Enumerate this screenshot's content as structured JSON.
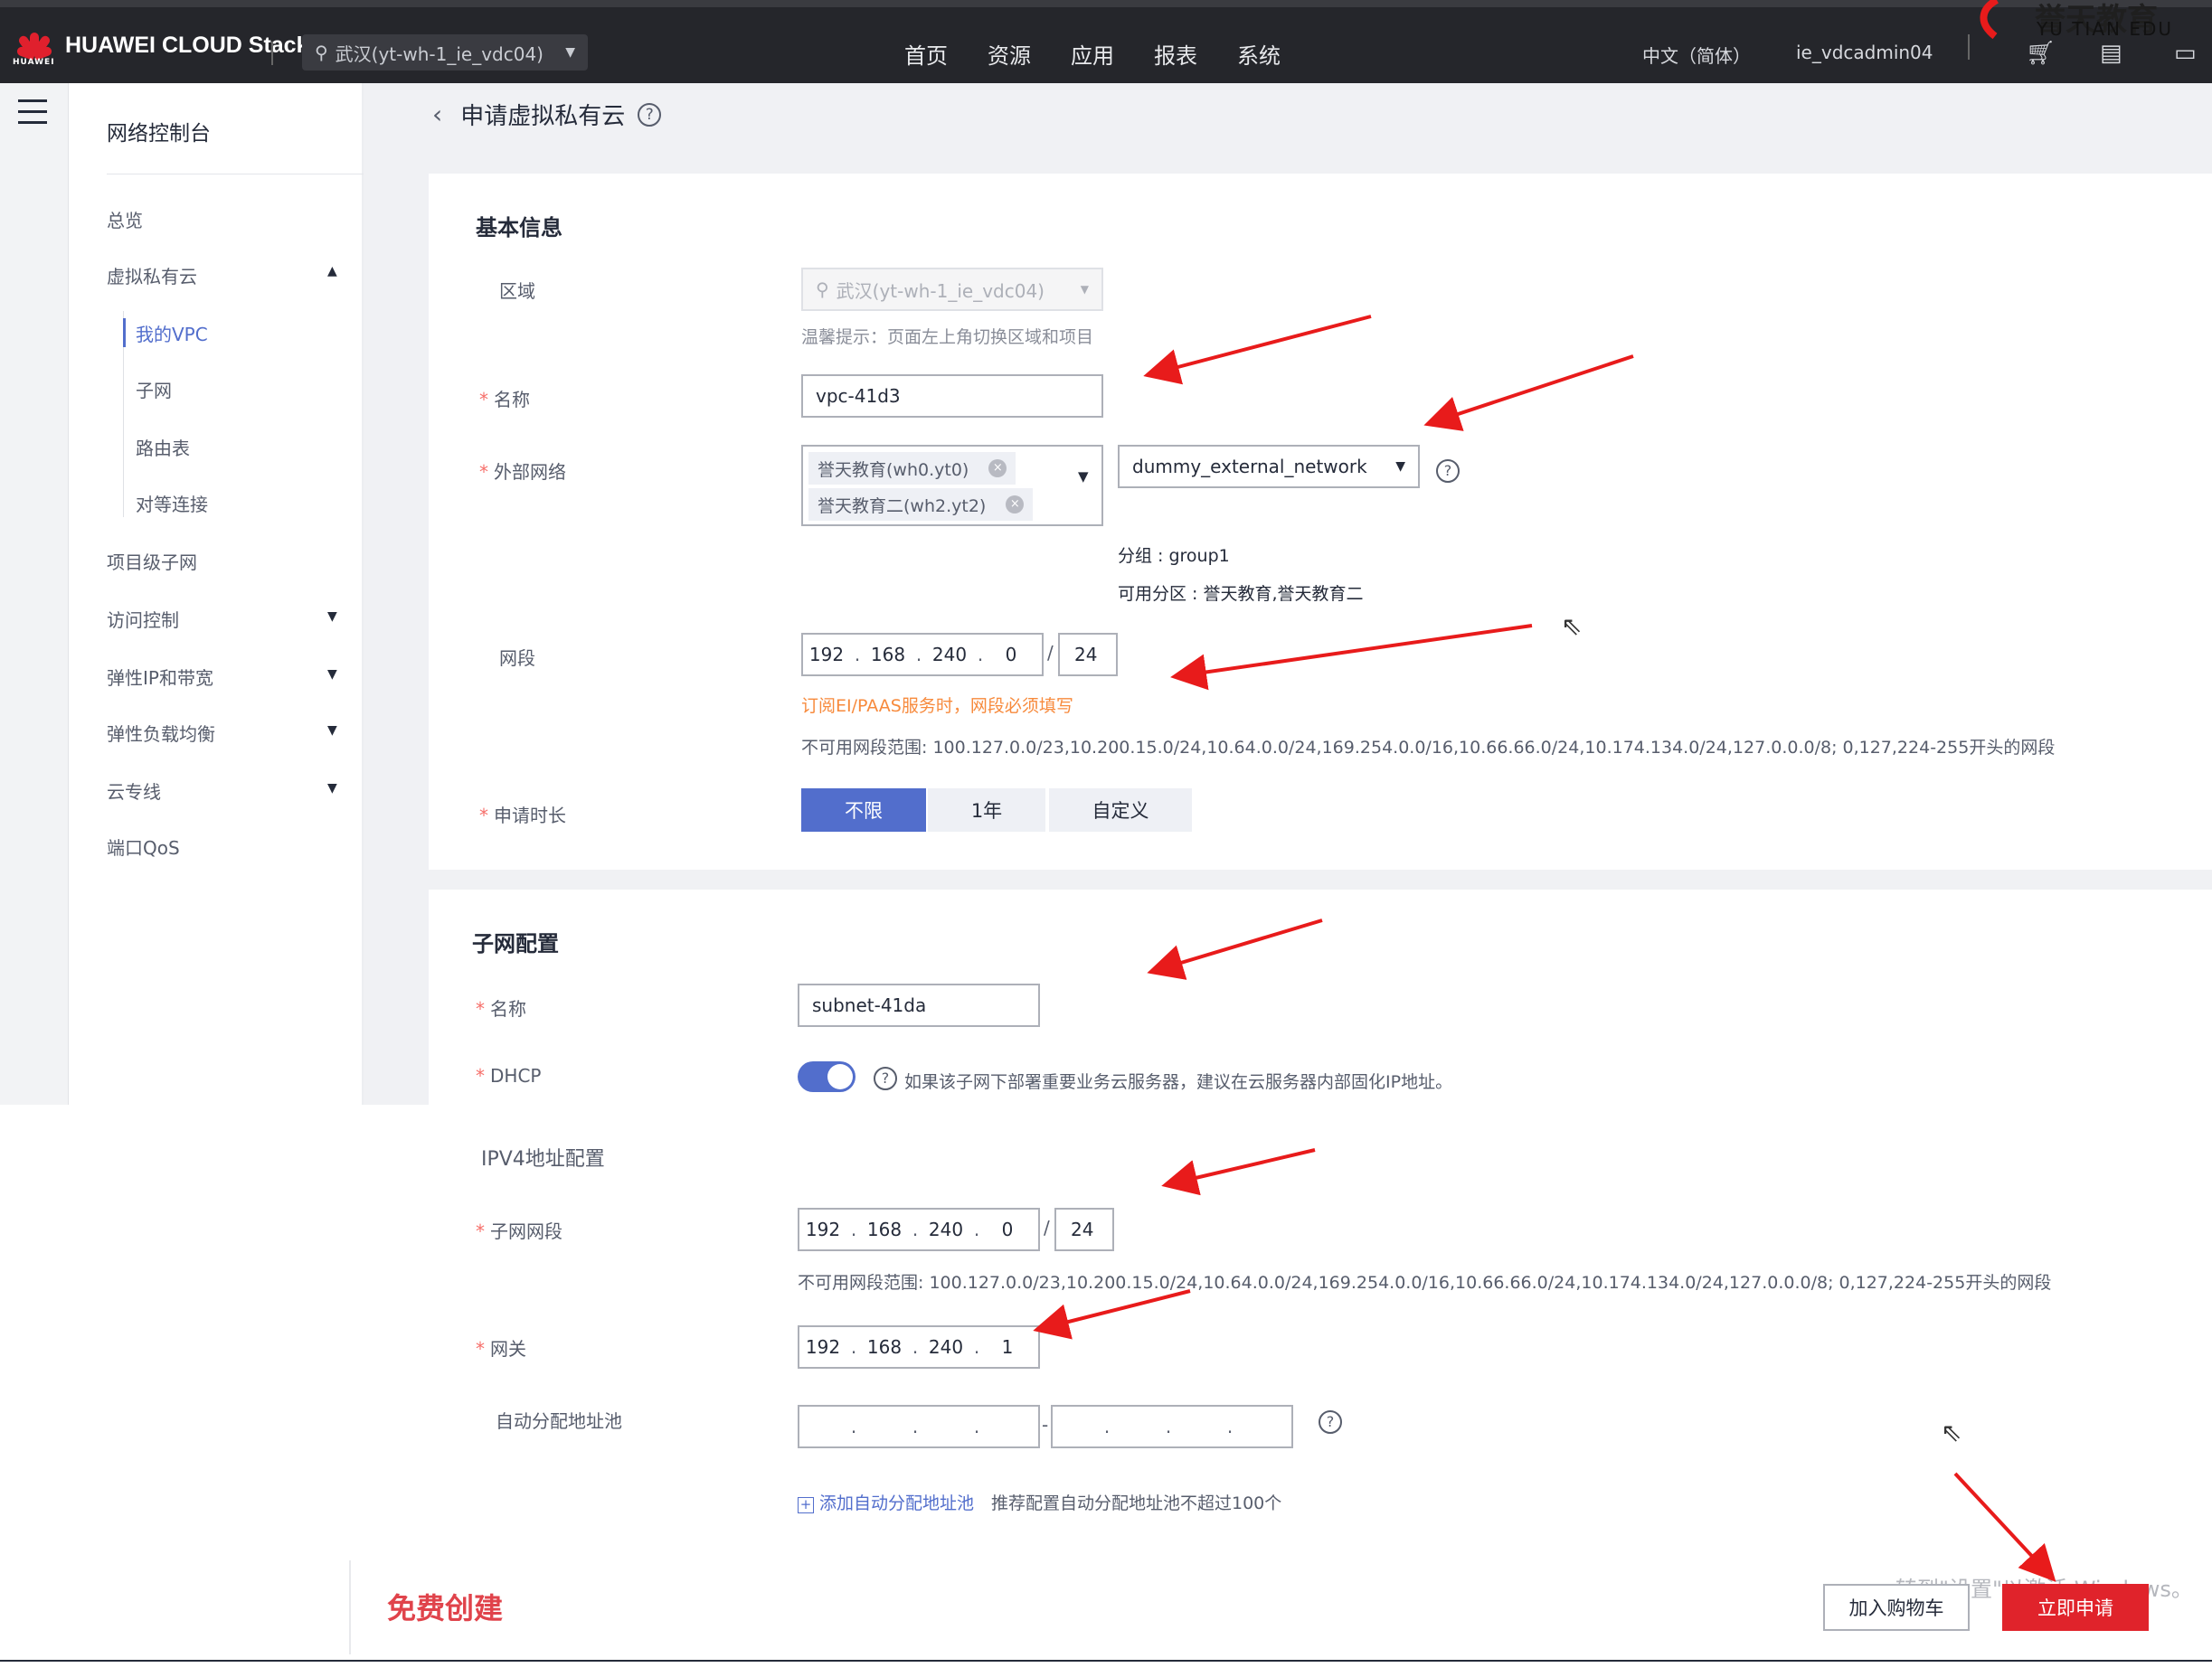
{
  "topbar": {
    "brand": "HUAWEI CLOUD Stack",
    "brand_sub": "HUAWEI",
    "region": "武汉(yt-wh-1_ie_vdc04)",
    "nav": [
      "首页",
      "资源",
      "应用",
      "报表",
      "系统"
    ],
    "language": "中文（简体）",
    "username": "ie_vdcadmin04",
    "watermark_cn": "誉天教育",
    "watermark_en": "YU TIAN EDU"
  },
  "sidebar": {
    "title": "网络控制台",
    "items": [
      "总览",
      "虚拟私有云",
      "我的VPC",
      "子网",
      "路由表",
      "对等连接",
      "项目级子网",
      "访问控制",
      "弹性IP和带宽",
      "弹性负载均衡",
      "云专线",
      "端口QoS"
    ]
  },
  "page": {
    "title": "申请虚拟私有云"
  },
  "basic": {
    "section_title": "基本信息",
    "region_label": "区域",
    "region_value": "武汉(yt-wh-1_ie_vdc04)",
    "region_tip": "温馨提示：页面左上角切换区域和项目",
    "name_label": "名称",
    "name_value": "vpc-41d3",
    "ext_network_label": "外部网络",
    "ext_network_tags": [
      "誉天教育(wh0.yt0)",
      "誉天教育二(wh2.yt2)"
    ],
    "ext_network_select": "dummy_external_network",
    "group_text": "分组 : group1",
    "az_text": "可用分区 : 誉天教育,誉天教育二",
    "segment_label": "网段",
    "segment_octets": [
      "192",
      "168",
      "240",
      "0"
    ],
    "segment_mask": "24",
    "segment_warn": "订阅EI/PAAS服务时，网段必须填写",
    "unavailable_ranges": "不可用网段范围: 100.127.0.0/23,10.200.15.0/24,10.64.0.0/24,169.254.0.0/16,10.66.66.0/24,10.174.134.0/24,127.0.0.0/8; 0,127,224-255开头的网段",
    "duration_label": "申请时长",
    "duration_options": [
      "不限",
      "1年",
      "自定义"
    ],
    "duration_selected": "不限"
  },
  "subnet": {
    "section_title": "子网配置",
    "name_label": "名称",
    "name_value": "subnet-41da",
    "dhcp_label": "DHCP",
    "dhcp_enabled": true,
    "dhcp_tip": "如果该子网下部署重要业务云服务器，建议在云服务器内部固化IP地址。",
    "ipv4_title": "IPV4地址配置",
    "segment_label": "子网网段",
    "segment_octets": [
      "192",
      "168",
      "240",
      "0"
    ],
    "segment_mask": "24",
    "unavailable_ranges": "不可用网段范围: 100.127.0.0/23,10.200.15.0/24,10.64.0.0/24,169.254.0.0/16,10.66.66.0/24,10.174.134.0/24,127.0.0.0/8; 0,127,224-255开头的网段",
    "gateway_label": "网关",
    "gateway_octets": [
      "192",
      "168",
      "240",
      "1"
    ],
    "pool_label": "自动分配地址池",
    "pool_dash": "-",
    "add_pool_link": "添加自动分配地址池",
    "add_pool_tip": "推荐配置自动分配地址池不超过100个"
  },
  "footer": {
    "free_text": "免费创建",
    "cart_button": "加入购物车",
    "apply_button": "立即申请",
    "windows_watermark": "转到\"设置\"以激活 Windows。"
  },
  "colors": {
    "accent": "#526ecc",
    "annotation_arrow": "#e81b1b",
    "apply_button": "#e0232b",
    "topbar": "#25262b"
  }
}
